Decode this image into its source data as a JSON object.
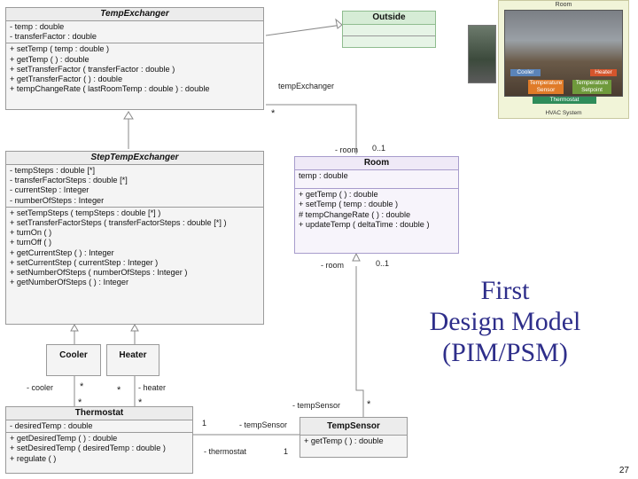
{
  "classes": {
    "temp_exchanger": {
      "name": "TempExchanger",
      "attributes": [
        "- temp : double",
        "- transferFactor : double"
      ],
      "operations": [
        "+ setTemp ( temp : double )",
        "+ getTemp ( ) : double",
        "+ setTransferFactor ( transferFactor : double )",
        "+ getTransferFactor ( ) : double",
        "+ tempChangeRate ( lastRoomTemp : double ) : double"
      ]
    },
    "outside": {
      "name": "Outside"
    },
    "step_temp_exchanger": {
      "name": "StepTempExchanger",
      "attributes": [
        "- tempSteps : double [*]",
        "- transferFactorSteps : double [*]",
        "- currentStep : Integer",
        "- numberOfSteps : Integer"
      ],
      "operations": [
        "+ setTempSteps ( tempSteps : double [*] )",
        "+ setTransferFactorSteps ( transferFactorSteps : double [*] )",
        "+ turnOn ( )",
        "+ turnOff ( )",
        "+ getCurrentStep ( ) : Integer",
        "+ setCurrentStep ( currentStep : Integer )",
        "+ setNumberOfSteps ( numberOfSteps : Integer )",
        "+ getNumberOfSteps ( ) : Integer"
      ]
    },
    "room": {
      "name": "Room",
      "attributes": [
        "temp : double"
      ],
      "operations": [
        "+ getTemp ( ) : double",
        "+ setTemp ( temp : double )",
        "# tempChangeRate ( ) : double",
        "+ updateTemp ( deltaTime : double )"
      ]
    },
    "cooler": {
      "name": "Cooler"
    },
    "heater": {
      "name": "Heater"
    },
    "thermostat": {
      "name": "Thermostat",
      "attributes": [
        "- desiredTemp : double"
      ],
      "operations": [
        "+ getDesiredTemp ( ) : double",
        "+ setDesiredTemp ( desiredTemp : double )",
        "+ regulate ( )"
      ]
    },
    "temp_sensor": {
      "name": "TempSensor",
      "operations": [
        "+ getTemp ( ) : double"
      ]
    }
  },
  "labels": {
    "temp_exchanger_role": "tempExchanger",
    "temp_exchanger_mult": "*",
    "room_role_top": "- room",
    "room_mult_top": "0..1",
    "room_role_bottom": "- room",
    "room_mult_bottom": "0..1",
    "cooler_role": "- cooler",
    "cooler_mult_a": "*",
    "cooler_mult_b": "*",
    "heater_role": "- heater",
    "heater_mult_a": "*",
    "heater_mult_b": "*",
    "temp_sensor_role_top": "- tempSensor",
    "temp_sensor_mult_top": "*",
    "temp_sensor_role_mid": "- tempSensor",
    "temp_sensor_mult_mid": "1",
    "thermostat_role": "- thermostat",
    "thermostat_mult": "1"
  },
  "hvac_figure": {
    "room_label": "Room",
    "cooler": "Cooler",
    "heater": "Heater",
    "temperature_sensor": "Temperature Sensor",
    "temperature_setpoint": "Temperature Setpoint",
    "thermostat": "Thermostat",
    "system_label": "HVAC System"
  },
  "title": {
    "line1": "First",
    "line2": "Design Model",
    "line3": "(PIM/PSM)"
  },
  "page_number": "27",
  "colors": {
    "title": "#2e2e8a",
    "outside_fill": "#e6f4e6",
    "room_fill": "#f7f4fb",
    "cooler_chip": "#5b84b8",
    "heater_chip": "#d4552c",
    "sensor_chip": "#e07b28",
    "setpoint_chip": "#6f9a3c",
    "thermostat_chip": "#2f8c5a"
  }
}
